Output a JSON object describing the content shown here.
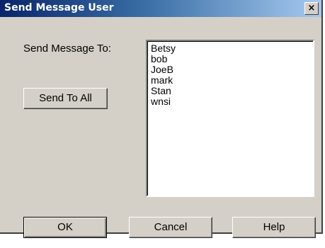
{
  "window": {
    "title": "Send Message User",
    "close_label": "×"
  },
  "form": {
    "prompt_label": "Send Message To:",
    "send_all_label": "Send To All"
  },
  "recipients": [
    "Betsy",
    "bob",
    "JoeB",
    "mark",
    "Stan",
    "wnsi"
  ],
  "buttons": {
    "ok_label": "OK",
    "cancel_label": "Cancel",
    "help_label": "Help"
  },
  "colors": {
    "dialog_face": "#d4d0c8",
    "titlebar_start": "#0a246a",
    "titlebar_end": "#a6caf0",
    "list_background": "#ffffff"
  }
}
